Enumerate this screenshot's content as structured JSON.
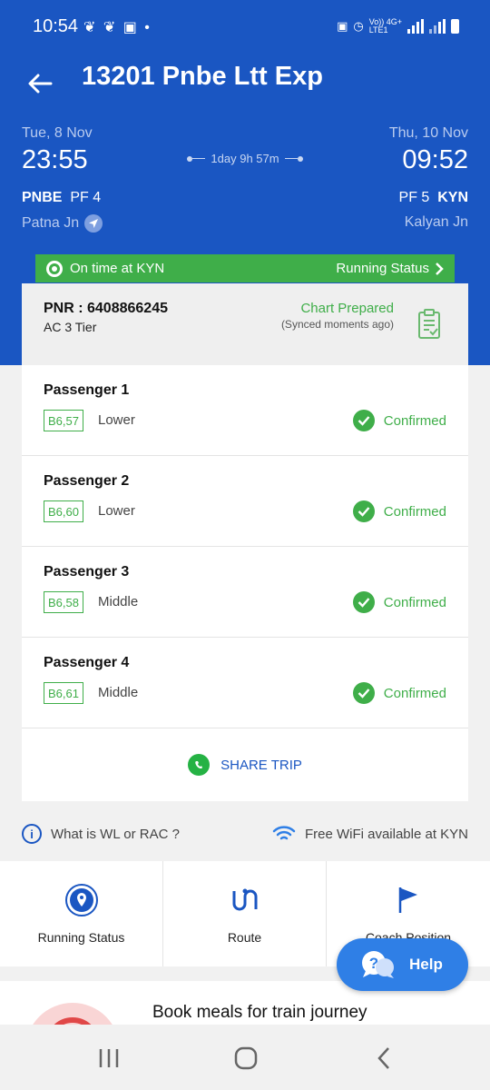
{
  "status_bar": {
    "time": "10:54",
    "left_icons": "❦ ❦ ▣ •",
    "right_text_1": "Vo)) 4G+",
    "right_text_2": "LTE1"
  },
  "header": {
    "title": "13201 Pnbe Ltt Exp",
    "departure": {
      "date": "Tue, 8 Nov",
      "time": "23:55",
      "code": "PNBE",
      "platform": "PF 4",
      "station": "Patna Jn"
    },
    "duration": "1day 9h 57m",
    "arrival": {
      "date": "Thu, 10 Nov",
      "time": "09:52",
      "code": "KYN",
      "platform": "PF 5",
      "station": "Kalyan Jn"
    }
  },
  "ontime": {
    "text": "On time at KYN",
    "link": "Running Status"
  },
  "pnr": {
    "label": "PNR : 6408866245",
    "class": "AC 3 Tier",
    "chart_status": "Chart Prepared",
    "synced": "(Synced moments ago)"
  },
  "passengers": [
    {
      "name": "Passenger 1",
      "berth": "B6,57",
      "type": "Lower",
      "status": "Confirmed"
    },
    {
      "name": "Passenger 2",
      "berth": "B6,60",
      "type": "Lower",
      "status": "Confirmed"
    },
    {
      "name": "Passenger 3",
      "berth": "B6,58",
      "type": "Middle",
      "status": "Confirmed"
    },
    {
      "name": "Passenger 4",
      "berth": "B6,61",
      "type": "Middle",
      "status": "Confirmed"
    }
  ],
  "share": {
    "label": "SHARE TRIP"
  },
  "info": {
    "wl_rac": "What is WL or RAC ?",
    "wifi": "Free WiFi available at KYN"
  },
  "shortcuts": [
    {
      "label": "Running Status",
      "icon": "location-pin-icon"
    },
    {
      "label": "Route",
      "icon": "route-icon"
    },
    {
      "label": "Coach Position",
      "icon": "flag-icon"
    }
  ],
  "meals": {
    "title": "Book meals for train journey"
  },
  "help": {
    "label": "Help"
  },
  "colors": {
    "primary": "#1a56c2",
    "success": "#3fae49",
    "help": "#2f7fe6",
    "whatsapp": "#25b244"
  }
}
